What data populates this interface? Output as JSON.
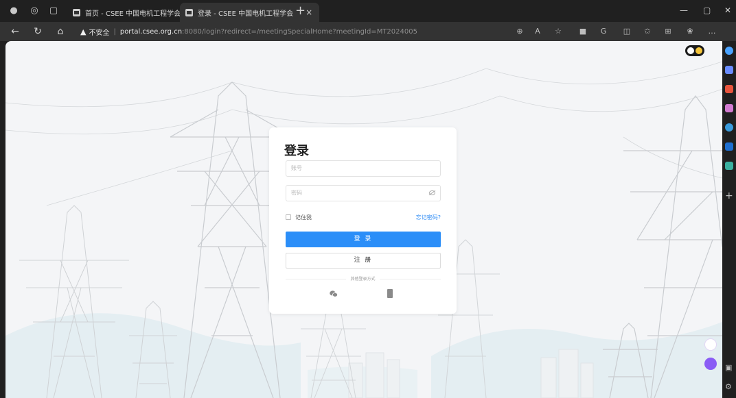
{
  "browser": {
    "tabs": [
      {
        "label": "首页 - CSEE 中国电机工程学会",
        "active": false
      },
      {
        "label": "登录 - CSEE 中国电机工程学会",
        "active": true
      }
    ],
    "close_glyph": "×",
    "new_tab_glyph": "+",
    "address": {
      "security_text": "不安全",
      "host": "portal.csee.org.cn",
      "path": ":8080/login?redirect=/meetingSpecialHome?meetingId=MT2024005"
    },
    "toolbar_icons": [
      "zoom-icon",
      "read-aloud-icon",
      "favorite-icon",
      "extension-icon",
      "refresh-extension-icon",
      "split-screen-icon",
      "favorites-icon",
      "collections-icon",
      "copilot-icon",
      "more-icon"
    ],
    "sidebar_icons": [
      "search-icon",
      "tag-icon",
      "shopping-icon",
      "people-icon",
      "copilot-icon",
      "outlook-icon",
      "drop-icon",
      "add-icon"
    ]
  },
  "login": {
    "title": "登录",
    "account_placeholder": "账号",
    "password_placeholder": "密码",
    "remember_label": "记住我",
    "forgot_label": "忘记密码?",
    "login_button": "登 录",
    "register_button": "注 册",
    "other_methods_label": "其他登录方式",
    "other_methods": [
      "wechat-icon",
      "phone-icon"
    ]
  },
  "colors": {
    "primary": "#2b8ef8",
    "link": "#2f8cf5",
    "page_bg": "#f4f5f7",
    "browser_dark": "#202020"
  }
}
